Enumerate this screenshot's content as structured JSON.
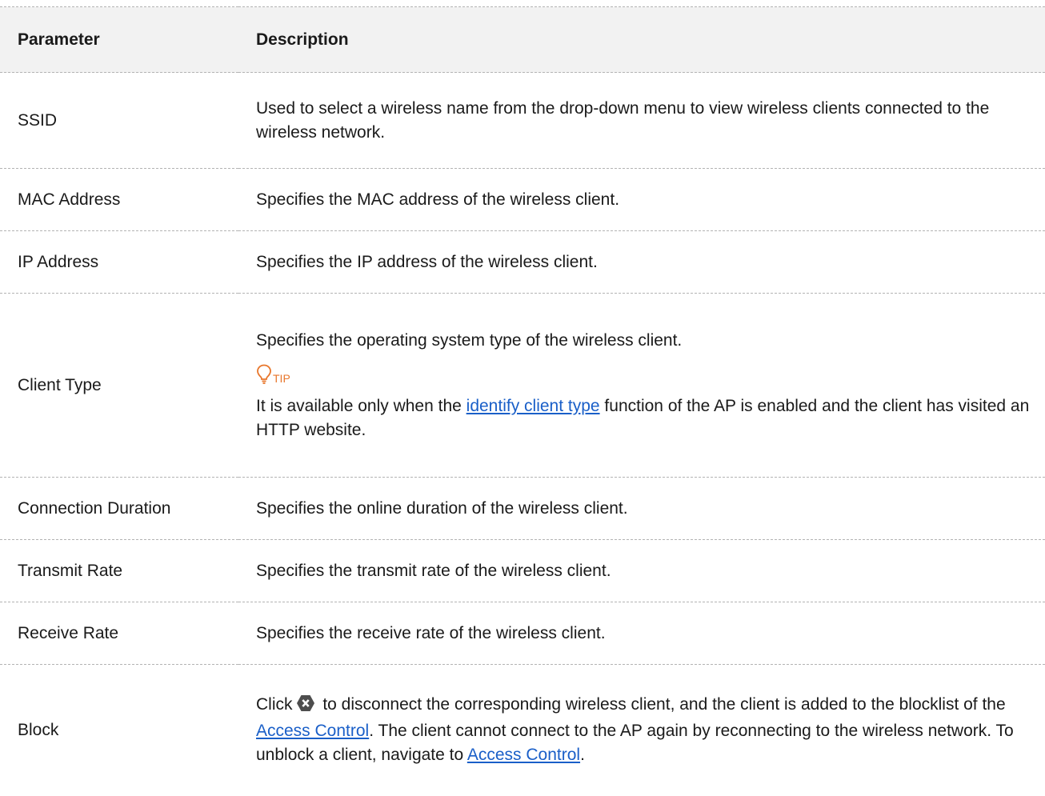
{
  "table": {
    "headers": {
      "parameter": "Parameter",
      "description": "Description"
    },
    "rows": {
      "ssid": {
        "parameter": "SSID",
        "description": "Used to select a wireless name from the drop-down menu to view wireless clients connected to the wireless network."
      },
      "mac": {
        "parameter": "MAC Address",
        "description": "Specifies the MAC address of the wireless client."
      },
      "ip": {
        "parameter": "IP Address",
        "description": "Specifies the IP address of the wireless client."
      },
      "client_type": {
        "parameter": "Client Type",
        "description": "Specifies the operating system type of the wireless client.",
        "tip_label": "TIP",
        "tip_icon": "lightbulb-icon",
        "tip_text_before": "It is available only when the ",
        "tip_link": "identify client type",
        "tip_text_after": " function of the AP is enabled and the client has visited an HTTP website."
      },
      "duration": {
        "parameter": "Connection Duration",
        "description": "Specifies the online duration of the wireless client."
      },
      "tx": {
        "parameter": "Transmit Rate",
        "description": "Specifies the transmit rate of the wireless client."
      },
      "rx": {
        "parameter": "Receive Rate",
        "description": "Specifies the receive rate of the wireless client."
      },
      "block": {
        "parameter": "Block",
        "desc_part1": "Click",
        "block_icon": "block-x-icon",
        "desc_part2": " to disconnect the corresponding wireless client, and the client is added to the blocklist of the ",
        "link1": "Access Control",
        "desc_part3": ". The client cannot connect to the AP again by reconnecting to the wireless network. To unblock a client, navigate to ",
        "link2": "Access Control",
        "desc_part4": "."
      }
    }
  },
  "colors": {
    "header_bg": "#f2f2f2",
    "link": "#1a5fc8",
    "tip_accent": "#e8762b",
    "block_icon": "#4d4d4d"
  }
}
